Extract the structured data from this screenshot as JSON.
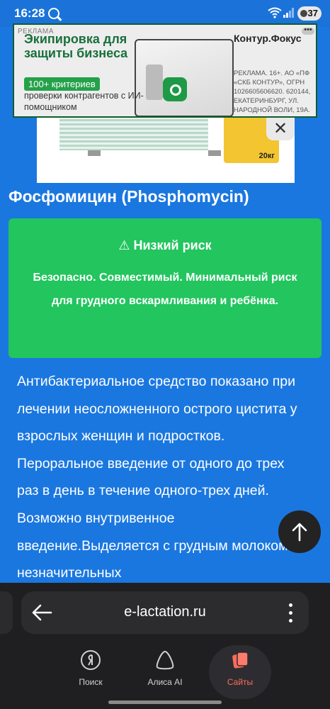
{
  "status_bar": {
    "time": "16:28",
    "battery": "37"
  },
  "ad": {
    "tag": "РЕКЛАМА",
    "title": "Экипировка для защиты бизнеса",
    "badge": "100+ критериев",
    "subtitle": "проверки контрагентов с ИИ-помощником",
    "brand": "Контур.Фокус",
    "legal": "РЕКЛАМА. 16+. АО «ПФ «СКБ КОНТУР», ОГРН 1026605606620. 620144, ЕКАТЕРИНБУРГ, УЛ. НАРОДНОЙ ВОЛИ, 19А.",
    "menu": "•••",
    "bag_label": "20кг"
  },
  "hero": {
    "close": "✕"
  },
  "drug": {
    "title": "Фосфомицин (Phosphomycin)"
  },
  "risk": {
    "heading": "⚠ Низкий риск",
    "text": "Безопасно. Совместимый. Минимальный риск для грудного вскармливания и ребёнка.",
    "color": "#22c55e"
  },
  "article": {
    "text": "Антибактериальное средство показано при лечении неосложненного острого цистита у взрослых женщин и подростков. Пероральное введение от одного до трех раз в день в течение одного-трех дней. Возможно внутривенное введение.Выделяется с грудным молоком в незначительных"
  },
  "browser": {
    "url": "e-lactation.ru",
    "nav": [
      {
        "label": "Поиск",
        "icon": "yandex-search-icon"
      },
      {
        "label": "Алиса AI",
        "icon": "alice-icon"
      },
      {
        "label": "Сайты",
        "icon": "sites-icon",
        "active": true
      }
    ]
  }
}
